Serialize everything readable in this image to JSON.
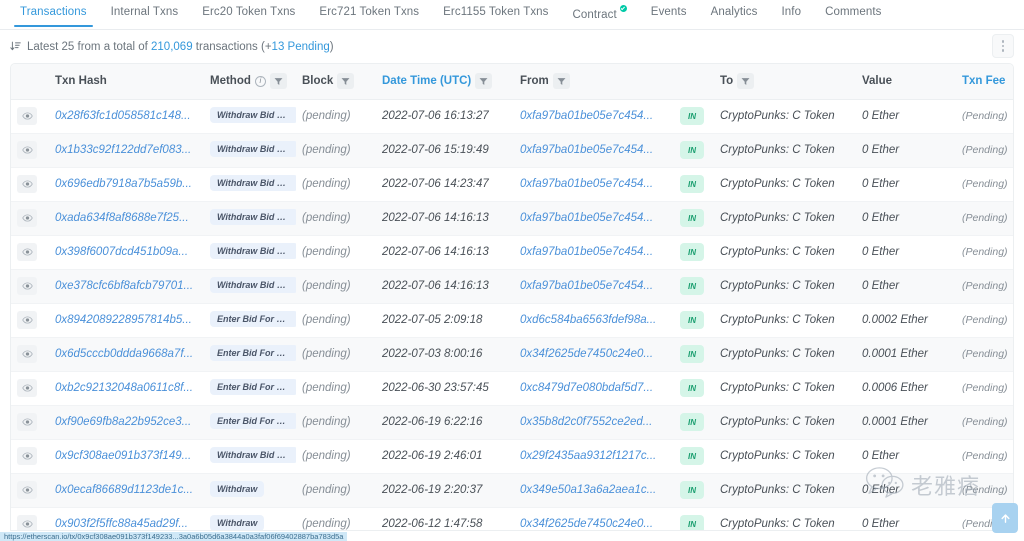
{
  "tabs": [
    {
      "label": "Transactions",
      "active": true,
      "verified": false
    },
    {
      "label": "Internal Txns",
      "active": false,
      "verified": false
    },
    {
      "label": "Erc20 Token Txns",
      "active": false,
      "verified": false
    },
    {
      "label": "Erc721 Token Txns",
      "active": false,
      "verified": false
    },
    {
      "label": "Erc1155 Token Txns",
      "active": false,
      "verified": false
    },
    {
      "label": "Contract",
      "active": false,
      "verified": true
    },
    {
      "label": "Events",
      "active": false,
      "verified": false
    },
    {
      "label": "Analytics",
      "active": false,
      "verified": false
    },
    {
      "label": "Info",
      "active": false,
      "verified": false
    },
    {
      "label": "Comments",
      "active": false,
      "verified": false
    }
  ],
  "summary": {
    "prefix": "Latest 25 from a total of ",
    "total": "210,069",
    "middle": " transactions (+",
    "pending": "13 Pending",
    "suffix": ")",
    "sort_icon": "sort-descending-icon",
    "kebab_icon": "more-options-icon"
  },
  "table": {
    "columns": [
      {
        "key": "eye",
        "label": "",
        "filter": false,
        "info": false,
        "blue": false
      },
      {
        "key": "hash",
        "label": "Txn Hash",
        "filter": false,
        "info": false,
        "blue": false
      },
      {
        "key": "method",
        "label": "Method",
        "filter": true,
        "info": true,
        "blue": false
      },
      {
        "key": "block",
        "label": "Block",
        "filter": true,
        "info": false,
        "blue": false
      },
      {
        "key": "time",
        "label": "Date Time (UTC)",
        "filter": true,
        "info": false,
        "blue": true
      },
      {
        "key": "from",
        "label": "From",
        "filter": true,
        "info": false,
        "blue": false
      },
      {
        "key": "inout",
        "label": "",
        "filter": false,
        "info": false,
        "blue": false
      },
      {
        "key": "to",
        "label": "To",
        "filter": true,
        "info": false,
        "blue": false
      },
      {
        "key": "value",
        "label": "Value",
        "filter": false,
        "info": false,
        "blue": false
      },
      {
        "key": "fee",
        "label": "Txn Fee",
        "filter": false,
        "info": false,
        "blue": true
      }
    ],
    "rows": [
      {
        "hash": "0x28f63fc1d058581c148...",
        "method": "Withdraw Bid For...",
        "block": "(pending)",
        "time": "2022-07-06 16:13:27",
        "from": "0xfa97ba01be05e7c454...",
        "inout": "IN",
        "to": "CryptoPunks: C Token",
        "value": "0 Ether",
        "fee": "(Pending)"
      },
      {
        "hash": "0x1b33c92f122dd7ef083...",
        "method": "Withdraw Bid For...",
        "block": "(pending)",
        "time": "2022-07-06 15:19:49",
        "from": "0xfa97ba01be05e7c454...",
        "inout": "IN",
        "to": "CryptoPunks: C Token",
        "value": "0 Ether",
        "fee": "(Pending)"
      },
      {
        "hash": "0x696edb7918a7b5a59b...",
        "method": "Withdraw Bid For...",
        "block": "(pending)",
        "time": "2022-07-06 14:23:47",
        "from": "0xfa97ba01be05e7c454...",
        "inout": "IN",
        "to": "CryptoPunks: C Token",
        "value": "0 Ether",
        "fee": "(Pending)"
      },
      {
        "hash": "0xada634f8af8688e7f25...",
        "method": "Withdraw Bid For...",
        "block": "(pending)",
        "time": "2022-07-06 14:16:13",
        "from": "0xfa97ba01be05e7c454...",
        "inout": "IN",
        "to": "CryptoPunks: C Token",
        "value": "0 Ether",
        "fee": "(Pending)"
      },
      {
        "hash": "0x398f6007dcd451b09a...",
        "method": "Withdraw Bid For...",
        "block": "(pending)",
        "time": "2022-07-06 14:16:13",
        "from": "0xfa97ba01be05e7c454...",
        "inout": "IN",
        "to": "CryptoPunks: C Token",
        "value": "0 Ether",
        "fee": "(Pending)"
      },
      {
        "hash": "0xe378cfc6bf8afcb79701...",
        "method": "Withdraw Bid For...",
        "block": "(pending)",
        "time": "2022-07-06 14:16:13",
        "from": "0xfa97ba01be05e7c454...",
        "inout": "IN",
        "to": "CryptoPunks: C Token",
        "value": "0 Ether",
        "fee": "(Pending)"
      },
      {
        "hash": "0x8942089228957814b5...",
        "method": "Enter Bid For Pu...",
        "block": "(pending)",
        "time": "2022-07-05 2:09:18",
        "from": "0xd6c584ba6563fdef98a...",
        "inout": "IN",
        "to": "CryptoPunks: C Token",
        "value": "0.0002 Ether",
        "fee": "(Pending)"
      },
      {
        "hash": "0x6d5cccb0ddda9668a7f...",
        "method": "Enter Bid For Pu...",
        "block": "(pending)",
        "time": "2022-07-03 8:00:16",
        "from": "0x34f2625de7450c24e0...",
        "inout": "IN",
        "to": "CryptoPunks: C Token",
        "value": "0.0001 Ether",
        "fee": "(Pending)"
      },
      {
        "hash": "0xb2c92132048a0611c8f...",
        "method": "Enter Bid For Pu...",
        "block": "(pending)",
        "time": "2022-06-30 23:57:45",
        "from": "0xc8479d7e080bdaf5d7...",
        "inout": "IN",
        "to": "CryptoPunks: C Token",
        "value": "0.0006 Ether",
        "fee": "(Pending)"
      },
      {
        "hash": "0xf90e69fb8a22b952ce3...",
        "method": "Enter Bid For Pu...",
        "block": "(pending)",
        "time": "2022-06-19 6:22:16",
        "from": "0x35b8d2c0f7552ce2ed...",
        "inout": "IN",
        "to": "CryptoPunks: C Token",
        "value": "0.0001 Ether",
        "fee": "(Pending)"
      },
      {
        "hash": "0x9cf308ae091b373f149...",
        "method": "Withdraw Bid For...",
        "block": "(pending)",
        "time": "2022-06-19 2:46:01",
        "from": "0x29f2435aa9312f1217c...",
        "inout": "IN",
        "to": "CryptoPunks: C Token",
        "value": "0 Ether",
        "fee": "(Pending)"
      },
      {
        "hash": "0x0ecaf86689d1123de1c...",
        "method": "Withdraw",
        "block": "(pending)",
        "time": "2022-06-19 2:20:37",
        "from": "0x349e50a13a6a2aea1c...",
        "inout": "IN",
        "to": "CryptoPunks: C Token",
        "value": "0 Ether",
        "fee": "(Pending)"
      },
      {
        "hash": "0x903f2f5ffc88a45ad29f...",
        "method": "Withdraw",
        "block": "(pending)",
        "time": "2022-06-12 1:47:58",
        "from": "0x34f2625de7450c24e0...",
        "inout": "IN",
        "to": "CryptoPunks: C Token",
        "value": "0 Ether",
        "fee": "(Pending)"
      }
    ]
  },
  "watermark": {
    "text": "老雅痞",
    "icon": "wechat-icon"
  },
  "to_top": {
    "icon": "arrow-up-icon"
  },
  "statusbar": {
    "url": "https://etherscan.io/tx/0x9cf308ae091b373f149233...3a0a6b05d6a3844a0a3faf06f69402887ba783d5a"
  },
  "colors": {
    "accent": "#3498db",
    "link": "#4a90d9",
    "verified": "#00c9a7",
    "in_badge_bg": "#d5f5e8",
    "in_badge_fg": "#1a9e6f",
    "method_badge_bg": "#eaf1fb",
    "row_alt": "#f8f9fa",
    "header_bg": "#f8f9fa"
  }
}
